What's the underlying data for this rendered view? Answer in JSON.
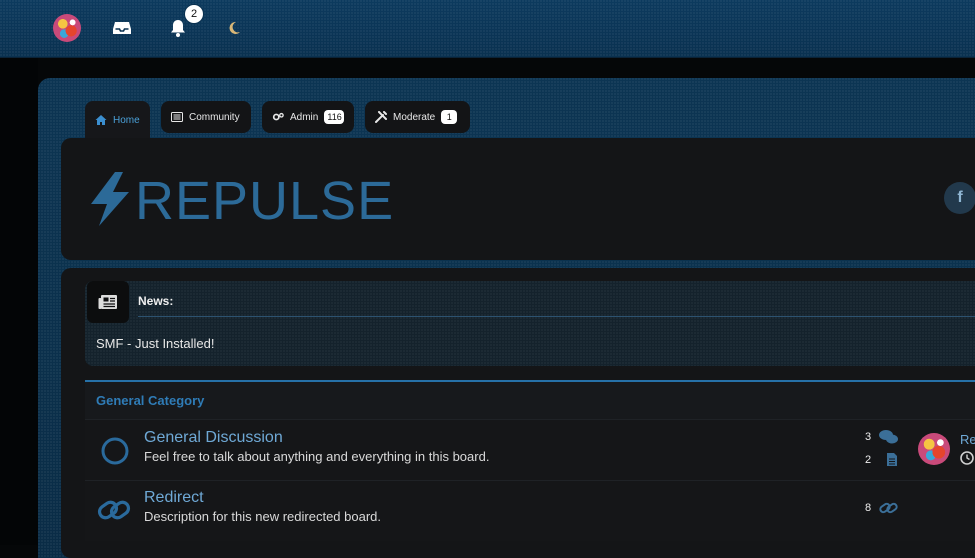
{
  "topbar": {
    "avatar_icon": "user-avatar",
    "inbox_icon": "inbox-icon",
    "notifications_icon": "bell-icon",
    "notifications_count": "2",
    "theme_icon": "moon-icon"
  },
  "tabs": [
    {
      "label": "Home",
      "icon": "home-icon",
      "active": true
    },
    {
      "label": "Community",
      "icon": "list-icon"
    },
    {
      "label": "Admin",
      "icon": "gears-icon",
      "count": "116"
    },
    {
      "label": "Moderate",
      "icon": "tools-icon",
      "count": "1"
    }
  ],
  "header": {
    "logo_text": "REPULSE",
    "logo_icon": "bolt-icon",
    "social_icon": "facebook-icon",
    "social_glyph": "f"
  },
  "news": {
    "title": "News:",
    "body": "SMF - Just Installed!",
    "icon": "newspaper-icon"
  },
  "category": {
    "title": "General Category",
    "boards": [
      {
        "name": "General Discussion",
        "description": "Feel free to talk about anything and everything in this board.",
        "icon": "board-circle-icon",
        "posts": "3",
        "topics": "2",
        "last_post_prefix": "Re"
      },
      {
        "name": "Redirect",
        "description": "Description for this new redirected board.",
        "icon": "redirect-link-icon",
        "redirects": "8"
      }
    ]
  },
  "colors": {
    "accent": "#2f7cb7",
    "topbar": "#0a3150",
    "panel": "#141517",
    "logo": "#2c6a98"
  }
}
